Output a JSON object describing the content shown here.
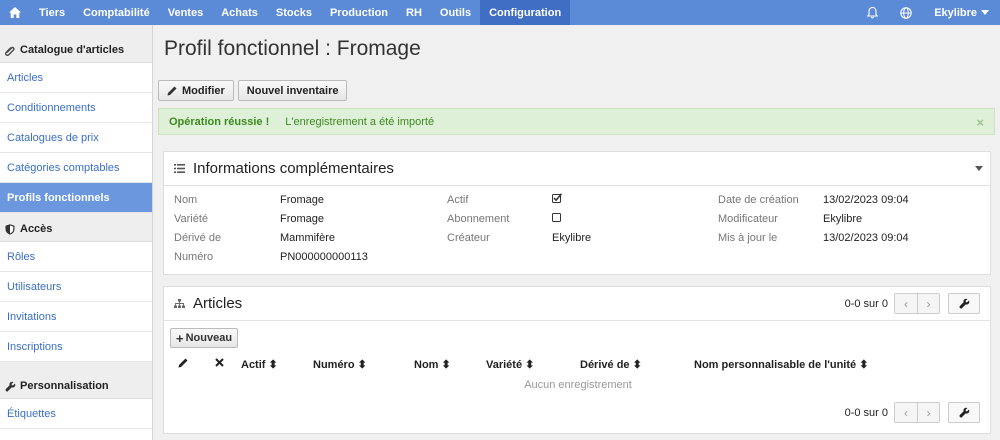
{
  "nav": {
    "home_icon": "home-icon",
    "items": [
      "Tiers",
      "Comptabilité",
      "Ventes",
      "Achats",
      "Stocks",
      "Production",
      "RH",
      "Outils",
      "Configuration"
    ],
    "active": "Configuration",
    "user": "Ekylibre"
  },
  "sidebar": {
    "sections": [
      {
        "title": "Catalogue d'articles",
        "icon": "paperclip-icon",
        "items": [
          "Articles",
          "Conditionnements",
          "Catalogues de prix",
          "Catégories comptables",
          "Profils fonctionnels"
        ]
      },
      {
        "title": "Accès",
        "icon": "shield-icon",
        "items": [
          "Rôles",
          "Utilisateurs",
          "Invitations",
          "Inscriptions"
        ]
      },
      {
        "title": "Personnalisation",
        "icon": "wrench-icon",
        "items": [
          "Étiquettes"
        ]
      }
    ],
    "active_item": "Profils fonctionnels"
  },
  "page": {
    "title": "Profil fonctionnel : Fromage",
    "buttons": {
      "edit": "Modifier",
      "new_inventory": "Nouvel inventaire"
    }
  },
  "alert": {
    "title": "Opération réussie !",
    "message": "L'enregistrement a été importé",
    "close": "×",
    "color": "#dff0d8"
  },
  "info": {
    "title": "Informations complémentaires",
    "col1": [
      {
        "label": "Nom",
        "value": "Fromage"
      },
      {
        "label": "Variété",
        "value": "Fromage"
      },
      {
        "label": "Dérivé de",
        "value": "Mammifère"
      },
      {
        "label": "Numéro",
        "value": "PN000000000113"
      }
    ],
    "col2": [
      {
        "label": "Actif",
        "checked": true
      },
      {
        "label": "Abonnement",
        "checked": false
      },
      {
        "label": "Créateur",
        "value": "Ekylibre"
      }
    ],
    "col3": [
      {
        "label": "Date de création",
        "value": "13/02/2023 09:04"
      },
      {
        "label": "Modificateur",
        "value": "Ekylibre"
      },
      {
        "label": "Mis à jour le",
        "value": "13/02/2023 09:04"
      }
    ]
  },
  "articles": {
    "title": "Articles",
    "pager": "0-0 sur 0",
    "new_button": "Nouveau",
    "columns": [
      "Actif",
      "Numéro",
      "Nom",
      "Variété",
      "Dérivé de",
      "Nom personnalisable de l'unité"
    ],
    "empty": "Aucun enregistrement"
  },
  "colors": {
    "nav": "#5b8bd6",
    "nav_active": "#3f6ec4",
    "sidebar_active": "#6a97de",
    "link": "#3a6fc4"
  }
}
